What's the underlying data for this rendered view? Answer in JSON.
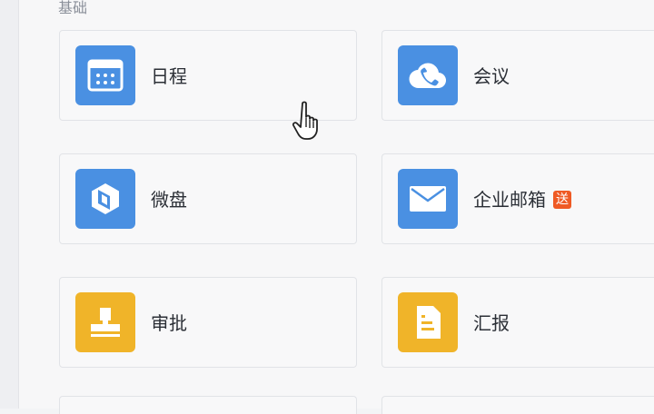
{
  "section": {
    "title": "基础"
  },
  "colors": {
    "blue": "#4a90e2",
    "yellow": "#f0b429",
    "badge": "#ef5a24"
  },
  "apps": [
    {
      "label": "日程",
      "icon": "calendar-icon"
    },
    {
      "label": "会议",
      "icon": "cloud-phone-icon"
    },
    {
      "label": "微盘",
      "icon": "drive-icon"
    },
    {
      "label": "企业邮箱",
      "icon": "mail-icon",
      "badge": "送"
    },
    {
      "label": "审批",
      "icon": "stamp-icon"
    },
    {
      "label": "汇报",
      "icon": "report-icon"
    }
  ]
}
